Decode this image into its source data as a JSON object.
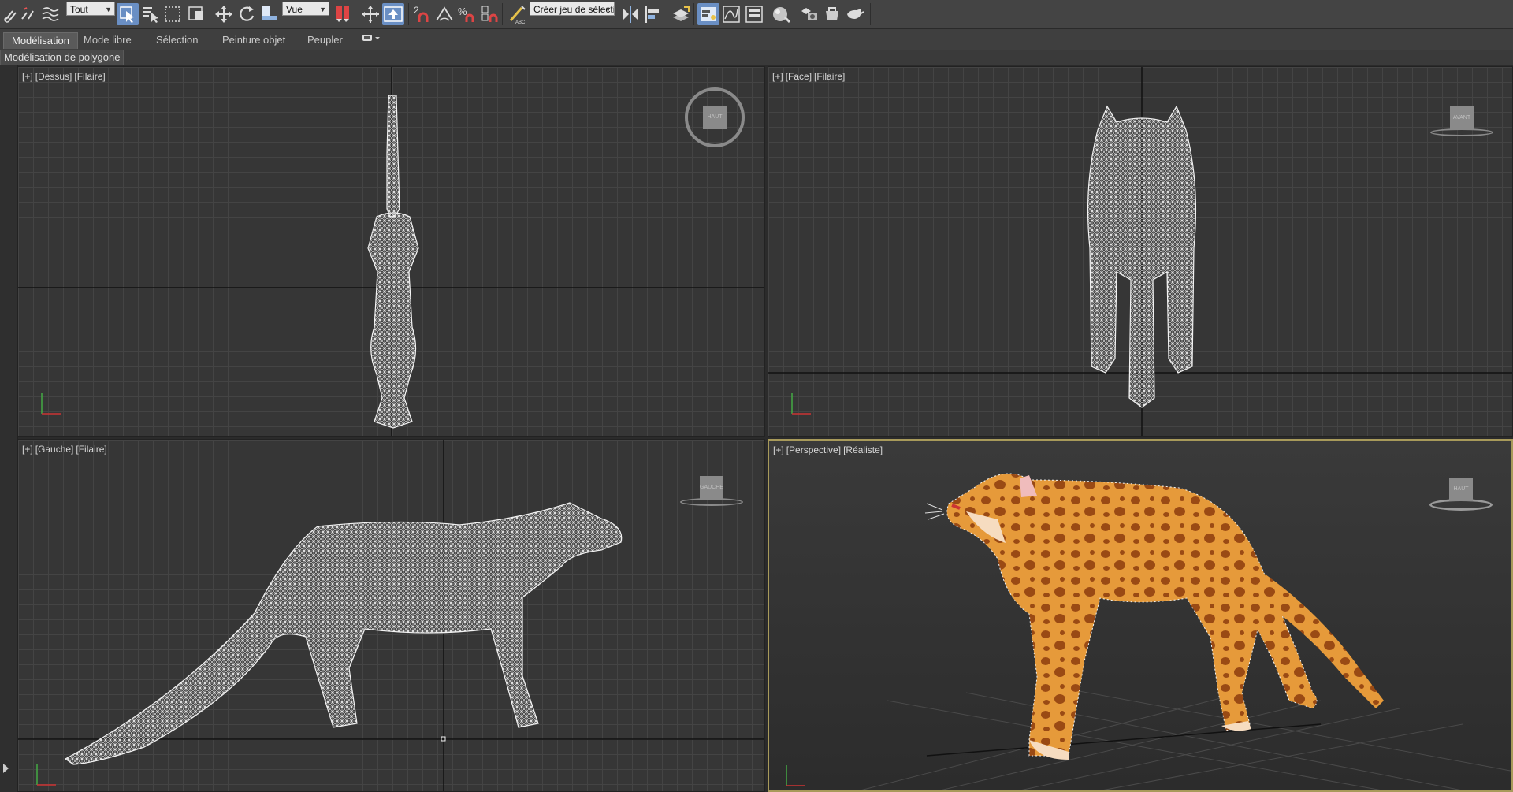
{
  "toolbar": {
    "selection_filter": "Tout",
    "reference_coord": "Vue",
    "named_selection_placeholder": "Créer jeu de sélecti"
  },
  "ribbon": {
    "tabs": [
      "Modélisation",
      "Mode libre",
      "Sélection",
      "Peinture objet",
      "Peupler"
    ],
    "active_tab": "Modélisation",
    "sub_label": "Modélisation de polygone"
  },
  "viewports": {
    "top": {
      "labels": [
        "[+]",
        "[Dessus]",
        "[Filaire]"
      ],
      "navcube": "HAUT"
    },
    "front": {
      "labels": [
        "[+]",
        "[Face]",
        "[Filaire]"
      ],
      "navcube": "AVANT"
    },
    "left": {
      "labels": [
        "[+]",
        "[Gauche]",
        "[Filaire]"
      ],
      "navcube": "GAUCHE"
    },
    "perspective": {
      "labels": [
        "[+]",
        "[Perspective]",
        "[Réaliste]"
      ],
      "navcube": "HAUT"
    }
  },
  "colors": {
    "active_tool": "#6a8fc4",
    "viewport_bg": "#363636",
    "active_viewport_border": "#a89a5a",
    "wireframe": "#f2f2f2",
    "fur": "#e69a3a",
    "spots": "#9a4a14"
  },
  "icons": {
    "toolbar": [
      "link-icon",
      "unlink-icon",
      "bind-space-warp-icon",
      "select-object-icon",
      "select-by-name-icon",
      "rect-selection-icon",
      "window-crossing-icon",
      "move-icon",
      "rotate-icon",
      "scale-icon",
      "pivot-icon",
      "keyboard-shortcut-icon",
      "snap-2d-icon",
      "angle-snap-icon",
      "percent-snap-icon",
      "spinner-snap-icon",
      "edit-named-selection-icon",
      "mirror-icon",
      "align-icon",
      "layer-manager-icon",
      "scene-explorer-icon",
      "curve-editor-icon",
      "schematic-view-icon",
      "material-editor-icon",
      "render-setup-icon",
      "render-frame-icon",
      "render-icon"
    ]
  }
}
